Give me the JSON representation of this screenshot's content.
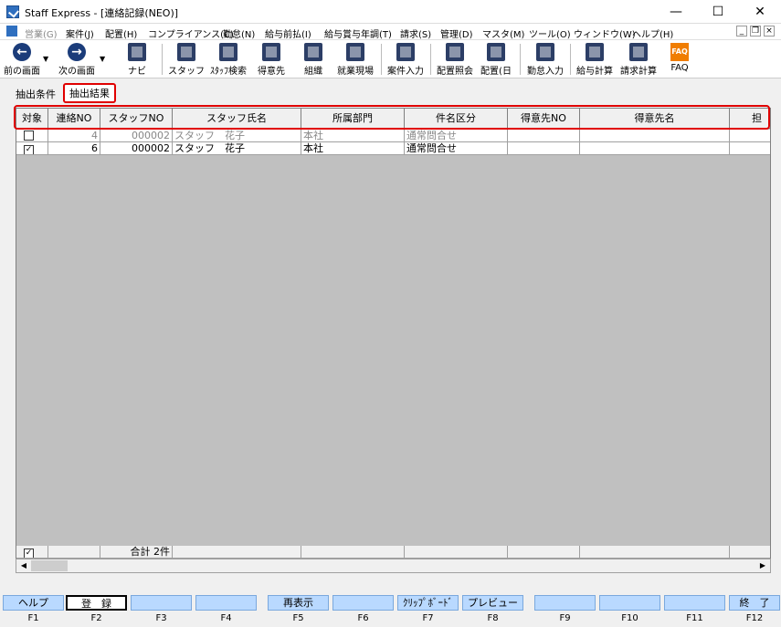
{
  "window": {
    "title": "Staff Express - [連絡記録(NEO)]",
    "minimize": "—",
    "maximize": "☐",
    "close": "✕"
  },
  "menu": [
    {
      "label": "営業(G)",
      "disabled": true
    },
    {
      "label": "案件(J)"
    },
    {
      "label": "配置(H)"
    },
    {
      "label": "コンプライアンス(C)"
    },
    {
      "label": "勤怠(N)"
    },
    {
      "label": "給与前払(I)"
    },
    {
      "label": "給与賞与年調(T)"
    },
    {
      "label": "請求(S)"
    },
    {
      "label": "管理(D)"
    },
    {
      "label": "マスタ(M)"
    },
    {
      "label": "ツール(O)"
    },
    {
      "label": "ウィンドウ(W)"
    },
    {
      "label": "ヘルプ(H)"
    }
  ],
  "mdi": {
    "min": "_",
    "restore": "❐",
    "close": "×"
  },
  "toolbar": {
    "back": "前の画面",
    "forward": "次の画面",
    "navi": "ナビ",
    "staff": "スタッフ",
    "staff_search": "ｽﾀｯﾌ検索",
    "client": "得意先",
    "org": "組織",
    "worksite": "就業現場",
    "case_input": "案件入力",
    "assign_query": "配置照会",
    "assign_day": "配置(日",
    "attendance": "勤怠入力",
    "payroll": "給与計算",
    "billing": "請求計算",
    "faq": "FAQ",
    "faq_icon_text": "FAQ"
  },
  "tabs": {
    "conditions": "抽出条件",
    "results": "抽出結果"
  },
  "columns": [
    "対象",
    "連絡NO",
    "スタッフNO",
    "スタッフ氏名",
    "所属部門",
    "件名区分",
    "得意先NO",
    "得意先名",
    "担"
  ],
  "rows": [
    {
      "checked": "",
      "no": "4",
      "staff_no": "000002",
      "name": "スタッフ　花子",
      "dept": "本社",
      "subject": "通常問合せ",
      "client_no": "",
      "client_name": ""
    },
    {
      "checked": "✓",
      "no": "6",
      "staff_no": "000002",
      "name": "スタッフ　花子",
      "dept": "本社",
      "subject": "通常問合せ",
      "client_no": "",
      "client_name": ""
    }
  ],
  "footer": {
    "checked": "✓",
    "total": "合計 2件"
  },
  "fkeys": [
    {
      "label": "ヘルプ",
      "key": "F1"
    },
    {
      "label": "登　録",
      "key": "F2"
    },
    {
      "label": "",
      "key": "F3"
    },
    {
      "label": "",
      "key": "F4"
    },
    {
      "label": "再表示",
      "key": "F5"
    },
    {
      "label": "",
      "key": "F6"
    },
    {
      "label": "ｸﾘｯﾌﾟﾎﾞｰﾄﾞ",
      "key": "F7"
    },
    {
      "label": "プレビュー",
      "key": "F8"
    },
    {
      "label": "",
      "key": "F9"
    },
    {
      "label": "",
      "key": "F10"
    },
    {
      "label": "",
      "key": "F11"
    },
    {
      "label": "終　了",
      "key": "F12"
    }
  ]
}
